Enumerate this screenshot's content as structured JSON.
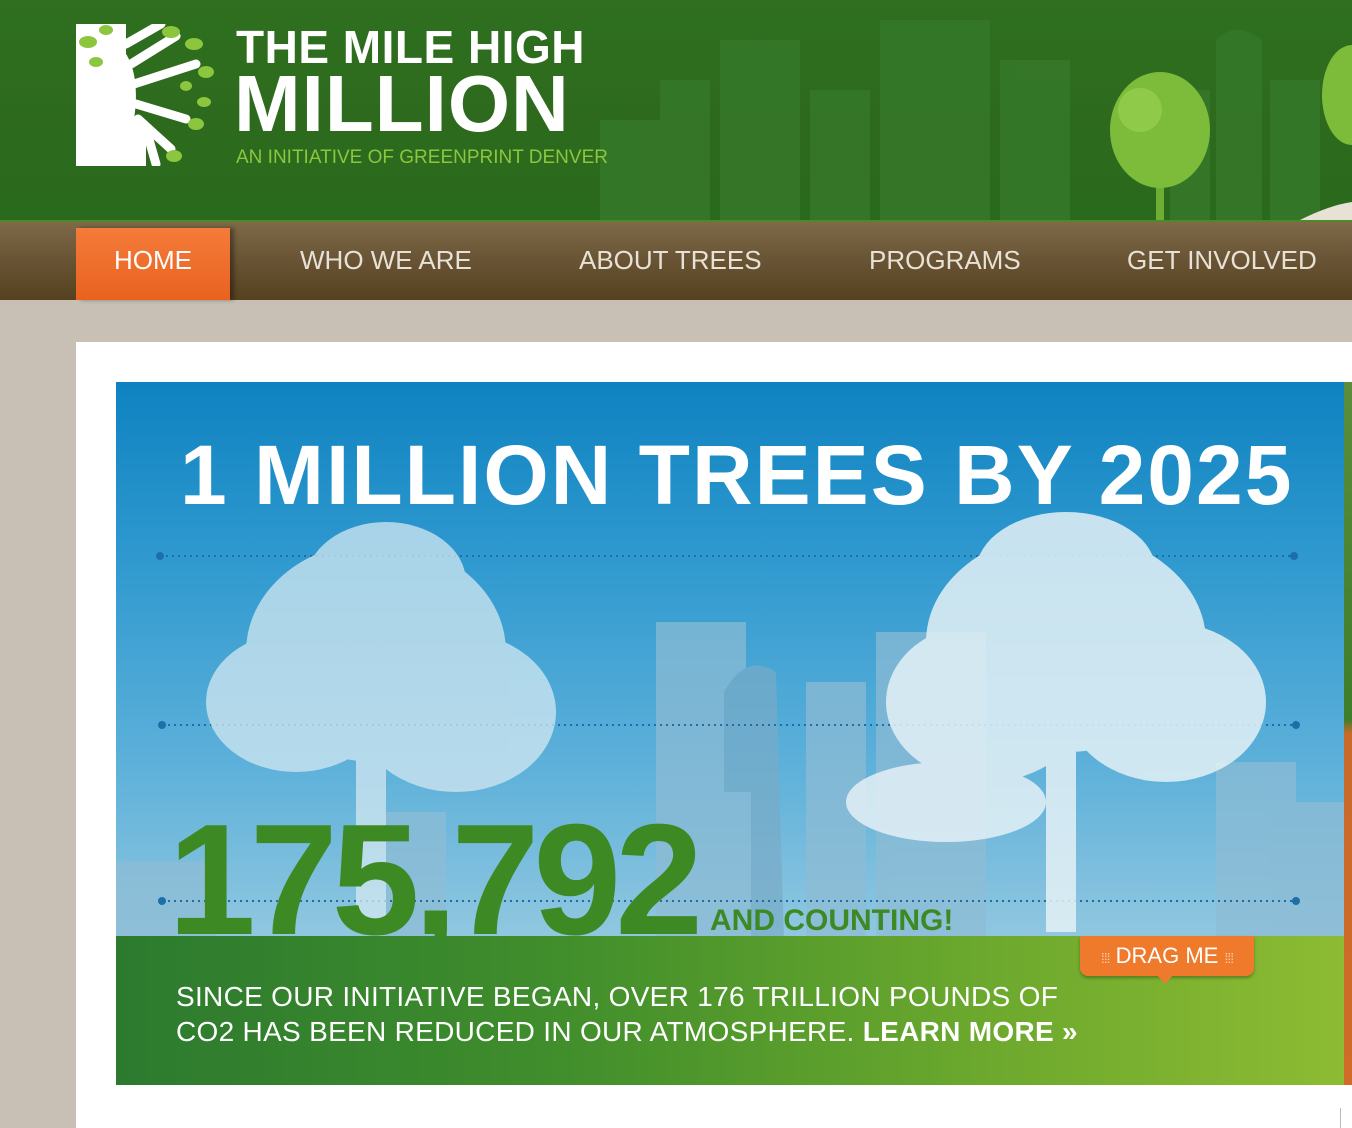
{
  "header": {
    "logo_line1": "THE MILE HIGH",
    "logo_line2": "MILLION",
    "tagline": "AN INITIATIVE OF GREENPRINT DENVER",
    "logo_icon": "tree-logo-icon"
  },
  "nav": {
    "items": [
      {
        "label": "HOME",
        "active": true
      },
      {
        "label": "WHO WE ARE",
        "active": false
      },
      {
        "label": "ABOUT TREES",
        "active": false
      },
      {
        "label": "PROGRAMS",
        "active": false
      },
      {
        "label": "GET INVOLVED",
        "active": false
      }
    ]
  },
  "hero": {
    "title": "1 MILLION TREES BY 2025",
    "counter": "175,792",
    "counter_suffix": "AND COUNTING!",
    "drag_label": "DRAG ME",
    "body_line1": "SINCE OUR INITIATIVE BEGAN, OVER 176 TRILLION POUNDS OF",
    "body_line2": "CO2 HAS BEEN REDUCED IN OUR ATMOSPHERE.",
    "learn_more": "LEARN MORE »"
  },
  "colors": {
    "header_green": "#2d6a1e",
    "nav_brown": "#6a5536",
    "active_orange": "#e9621f",
    "accent_green": "#8cc63f",
    "counter_green": "#3d8a24"
  }
}
